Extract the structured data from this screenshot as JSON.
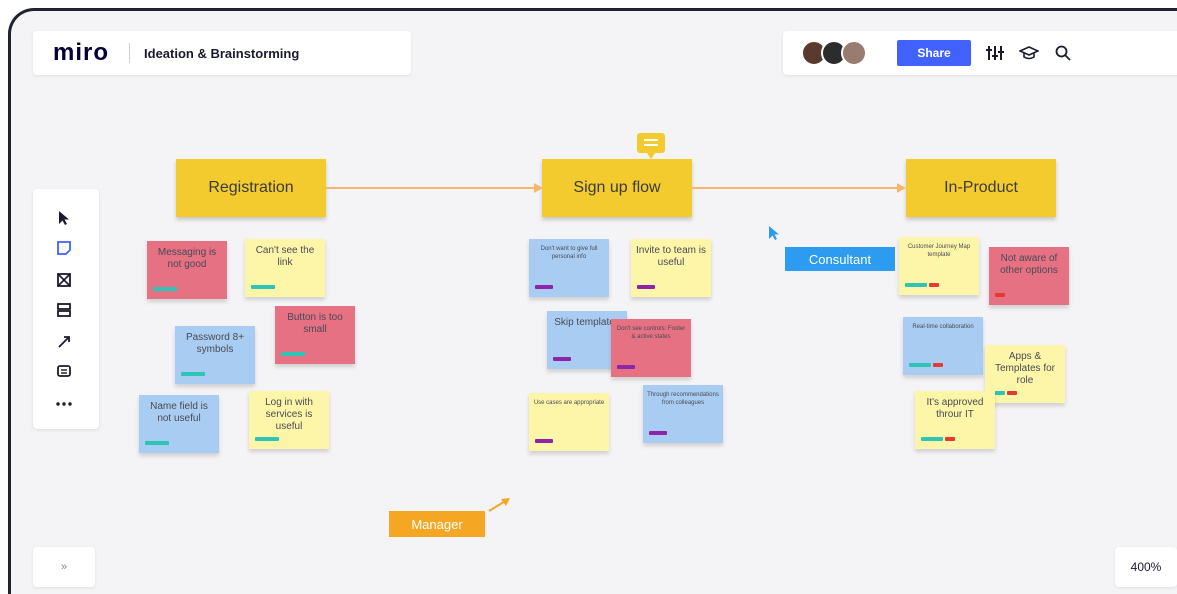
{
  "app": {
    "logo": "miro",
    "board_title": "Ideation & Brainstorming"
  },
  "header": {
    "share_label": "Share",
    "avatars": [
      "user-avatar-1",
      "user-avatar-2",
      "user-avatar-3"
    ]
  },
  "toolbar": {
    "tools": [
      "select-tool",
      "sticky-note-tool",
      "frame-tool",
      "template-tool",
      "connector-tool",
      "comment-tool",
      "more-tools"
    ]
  },
  "footer": {
    "collapse_label": "»",
    "zoom": "400%"
  },
  "colors": {
    "yellow": "#f3cb2e",
    "blue": "#4262ff",
    "pink": "#e57183",
    "light_yellow": "#fdf6a9",
    "light_blue": "#a9cdf2",
    "arrow": "#f6b76a",
    "manager": "#f5a623",
    "consultant": "#2d9bf0"
  },
  "columns": [
    {
      "title": "Registration"
    },
    {
      "title": "Sign up flow"
    },
    {
      "title": "In-Product"
    }
  ],
  "notes": {
    "registration": [
      {
        "text": "Messaging is not good",
        "color": "pink"
      },
      {
        "text": "Can't see the link",
        "color": "yellow"
      },
      {
        "text": "Password 8+ symbols",
        "color": "blue"
      },
      {
        "text": "Button is too small",
        "color": "pink"
      },
      {
        "text": "Name field is not useful",
        "color": "blue"
      },
      {
        "text": "Log in with services is useful",
        "color": "yellow"
      }
    ],
    "signup": [
      {
        "text": "Don't want to give full personal info",
        "color": "blue"
      },
      {
        "text": "Invite to team is useful",
        "color": "yellow"
      },
      {
        "text": "Skip templates",
        "color": "blue"
      },
      {
        "text": "Don't see controls: Footer & active states",
        "color": "pink"
      },
      {
        "text": "Use cases are appropriate",
        "color": "yellow"
      },
      {
        "text": "Through recommendations from colleagues",
        "color": "blue"
      }
    ],
    "inproduct": [
      {
        "text": "Customer Journey Map template",
        "color": "yellow"
      },
      {
        "text": "Not aware of other options",
        "color": "pink"
      },
      {
        "text": "Real-time collaboration",
        "color": "blue"
      },
      {
        "text": "Apps & Templates for role",
        "color": "yellow"
      },
      {
        "text": "It's approved throur IT",
        "color": "yellow"
      }
    ]
  },
  "cursors": {
    "consultant": "Consultant",
    "manager": "Manager"
  }
}
